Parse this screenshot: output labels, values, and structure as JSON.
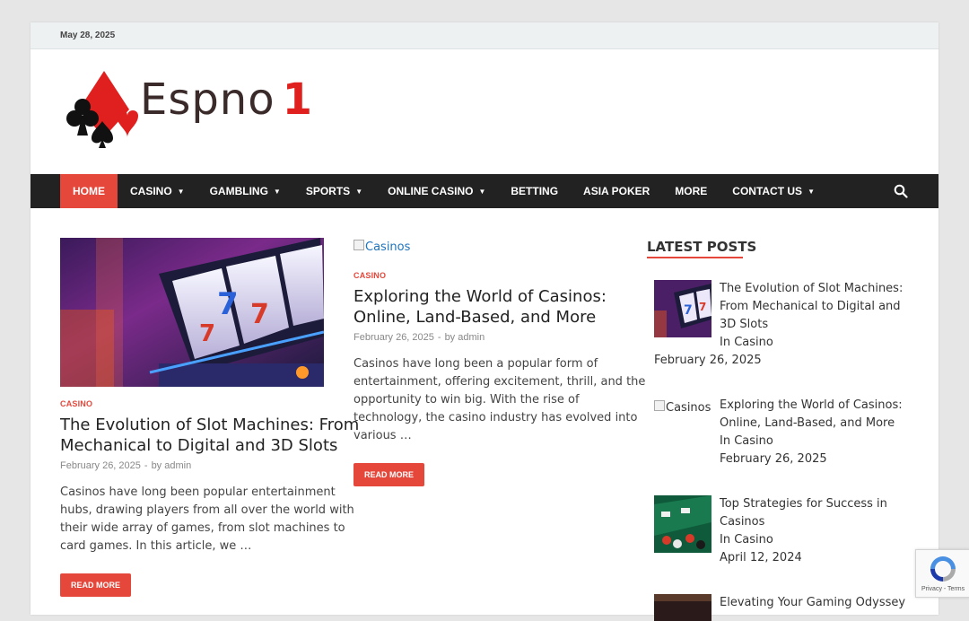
{
  "topbar": {
    "date": "May 28, 2025"
  },
  "brand": {
    "name": "Espno",
    "number": "1"
  },
  "nav": {
    "items": [
      {
        "label": "Home",
        "active": true,
        "dropdown": false
      },
      {
        "label": "Casino",
        "active": false,
        "dropdown": true
      },
      {
        "label": "Gambling",
        "active": false,
        "dropdown": true
      },
      {
        "label": "Sports",
        "active": false,
        "dropdown": true
      },
      {
        "label": "Online Casino",
        "active": false,
        "dropdown": true
      },
      {
        "label": "Betting",
        "active": false,
        "dropdown": false
      },
      {
        "label": "Asia Poker",
        "active": false,
        "dropdown": false
      },
      {
        "label": "More",
        "active": false,
        "dropdown": false
      },
      {
        "label": "Contact Us",
        "active": false,
        "dropdown": true
      }
    ],
    "search_icon": "search-icon"
  },
  "posts": [
    {
      "category": "CASINO",
      "title_line1": "The Evolution of Slot Machines: From",
      "title_line2": "Mechanical to Digital and 3D Slots",
      "date": "February 26, 2025",
      "separator": "-",
      "by": "by",
      "author": "admin",
      "excerpt": [
        "Casinos have long been popular entertainment",
        "hubs, drawing players from all over the world with",
        "their wide array of games, from slot machines to",
        "card games. In this article, we …"
      ],
      "button": "READ MORE"
    },
    {
      "image_alt": "Casinos",
      "category": "CASINO",
      "title_line1": "Exploring the World of Casinos:",
      "title_line2": "Online, Land-Based, and More",
      "date": "February 26, 2025",
      "separator": "-",
      "by": "by",
      "author": "admin",
      "excerpt": [
        "Casinos have long been a popular form of",
        "entertainment, offering excitement, thrill, and the",
        "opportunity to win big. With the rise of",
        "technology, the casino industry has evolved into",
        "various …"
      ],
      "button": "READ MORE"
    }
  ],
  "sidebar": {
    "title": "LATEST POSTS",
    "items": [
      {
        "title": [
          "The Evolution of Slot Machines:",
          "From Mechanical to Digital and",
          "3D Slots"
        ],
        "category": "In Casino",
        "date": "February 26, 2025"
      },
      {
        "image_alt": "Casinos",
        "title": [
          "Exploring the World of Casinos:",
          "Online, Land-Based, and More"
        ],
        "category": "In Casino",
        "date": "February 26, 2025"
      },
      {
        "title": [
          "Top Strategies for Success in",
          "Casinos"
        ],
        "category": "In Casino",
        "date": "April 12, 2024"
      },
      {
        "title": [
          "Elevating Your Gaming Odyssey:"
        ]
      }
    ]
  },
  "recaptcha": {
    "text": "Privacy - Terms"
  },
  "colors": {
    "accent": "#e5473b",
    "nav_bg": "#222222",
    "topbar_bg": "#eef1f2"
  }
}
